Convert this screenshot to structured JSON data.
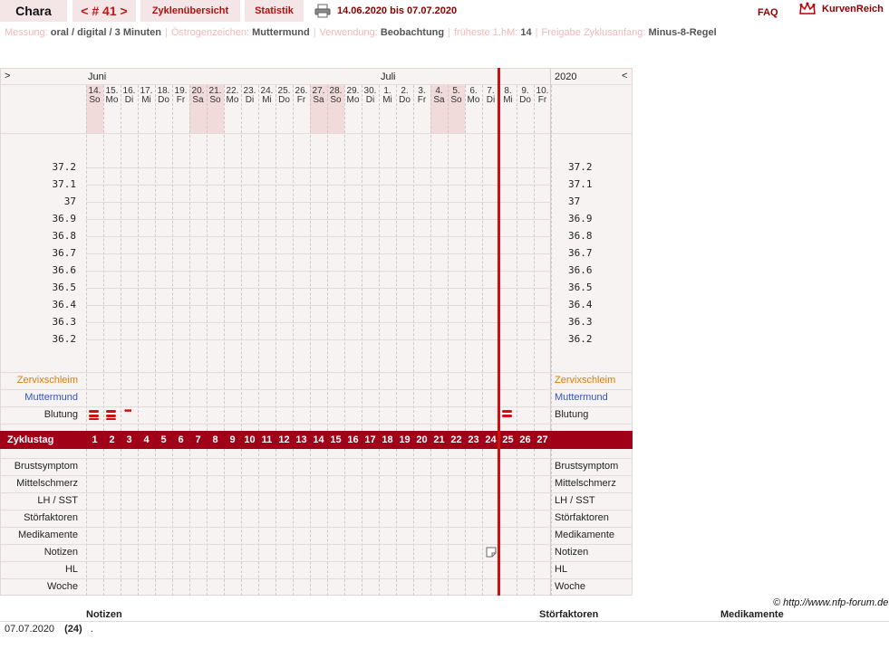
{
  "header": {
    "name": "Chara",
    "cycle_nav": "< # 41 >",
    "overview": "Zyklenübersicht",
    "stats": "Statistik",
    "print_icon": "printer-icon",
    "date_range": "14.06.2020 bis 07.07.2020",
    "faq": "FAQ",
    "logo_icon": "crown-icon",
    "logo": "KurvenReich"
  },
  "info": {
    "messung_label": "Messung:",
    "messung_value": "oral / digital / 3 Minuten",
    "oestrogen_label": "Östrogenzeichen:",
    "oestrogen_value": "Muttermund",
    "verwendung_label": "Verwendung:",
    "verwendung_value": "Beobachtung",
    "hm_label": "früheste 1.hM:",
    "hm_value": "14",
    "freigabe_label": "Freigabe Zyklusanfang:",
    "freigabe_value": "Minus-8-Regel"
  },
  "chart": {
    "left_arrow": ">",
    "right_arrow": "<",
    "year": "2020",
    "month_labels": [
      {
        "label": "Juni",
        "col": 0
      },
      {
        "label": "Juli",
        "col": 17
      }
    ],
    "days": [
      {
        "d": "14.",
        "w": "So",
        "we": true
      },
      {
        "d": "15.",
        "w": "Mo",
        "we": false
      },
      {
        "d": "16.",
        "w": "Di",
        "we": false
      },
      {
        "d": "17.",
        "w": "Mi",
        "we": false
      },
      {
        "d": "18.",
        "w": "Do",
        "we": false
      },
      {
        "d": "19.",
        "w": "Fr",
        "we": false
      },
      {
        "d": "20.",
        "w": "Sa",
        "we": true
      },
      {
        "d": "21.",
        "w": "So",
        "we": true
      },
      {
        "d": "22.",
        "w": "Mo",
        "we": false
      },
      {
        "d": "23.",
        "w": "Di",
        "we": false
      },
      {
        "d": "24.",
        "w": "Mi",
        "we": false
      },
      {
        "d": "25.",
        "w": "Do",
        "we": false
      },
      {
        "d": "26.",
        "w": "Fr",
        "we": false
      },
      {
        "d": "27.",
        "w": "Sa",
        "we": true
      },
      {
        "d": "28.",
        "w": "So",
        "we": true
      },
      {
        "d": "29.",
        "w": "Mo",
        "we": false
      },
      {
        "d": "30.",
        "w": "Di",
        "we": false
      },
      {
        "d": "1.",
        "w": "Mi",
        "we": false
      },
      {
        "d": "2.",
        "w": "Do",
        "we": false
      },
      {
        "d": "3.",
        "w": "Fr",
        "we": false
      },
      {
        "d": "4.",
        "w": "Sa",
        "we": true
      },
      {
        "d": "5.",
        "w": "So",
        "we": true
      },
      {
        "d": "6.",
        "w": "Mo",
        "we": false
      },
      {
        "d": "7.",
        "w": "Di",
        "we": false
      },
      {
        "d": "8.",
        "w": "Mi",
        "we": false
      },
      {
        "d": "9.",
        "w": "Do",
        "we": false
      },
      {
        "d": "10.",
        "w": "Fr",
        "we": false
      }
    ],
    "temp_ticks": [
      "37.2",
      "37.1",
      "37",
      "36.9",
      "36.8",
      "36.7",
      "36.6",
      "36.5",
      "36.4",
      "36.3",
      "36.2"
    ],
    "rows_upper": [
      {
        "label": "Zervixschleim",
        "color": "#e07b00"
      },
      {
        "label": "Muttermund",
        "color": "#3355bb"
      },
      {
        "label": "Blutung",
        "color": "#222222"
      }
    ],
    "cycle_label": "Zyklustag",
    "cycle_days": [
      "1",
      "2",
      "3",
      "4",
      "5",
      "6",
      "7",
      "8",
      "9",
      "10",
      "11",
      "12",
      "13",
      "14",
      "15",
      "16",
      "17",
      "18",
      "19",
      "20",
      "21",
      "22",
      "23",
      "24",
      "25",
      "26",
      "27"
    ],
    "rows_lower": [
      "Brustsymptom",
      "Mittelschmerz",
      "LH / SST",
      "Störfaktoren",
      "Medikamente",
      "Notizen",
      "HL",
      "Woche"
    ],
    "bleeding": [
      {
        "col": 0,
        "type": "heavy"
      },
      {
        "col": 1,
        "type": "heavy"
      },
      {
        "col": 2,
        "type": "spotting"
      },
      {
        "col": 24,
        "type": "medium"
      }
    ],
    "note_icon_col": 23,
    "note_icon": "note-icon"
  },
  "footer": {
    "copyright": "© http://www.nfp-forum.de",
    "notizen": "Notizen",
    "stoerfaktoren": "Störfaktoren",
    "medikamente": "Medikamente",
    "note_date": "07.07.2020",
    "note_day": "(24)",
    "note_text": "."
  }
}
